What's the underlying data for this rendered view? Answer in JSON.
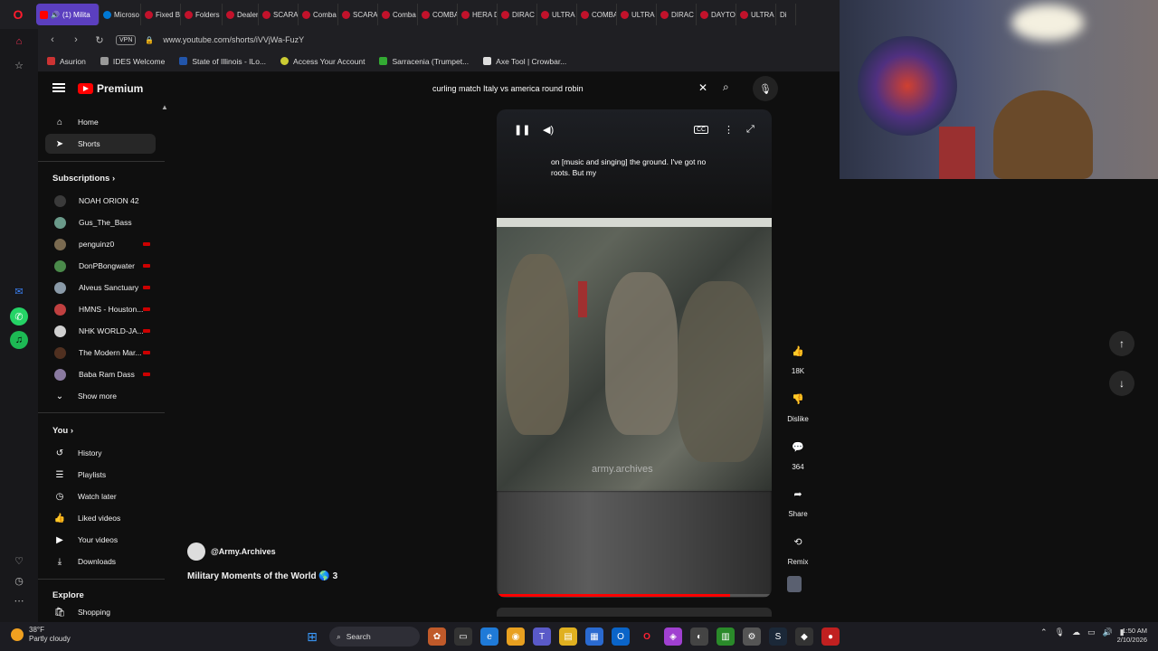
{
  "browser": {
    "tabs": [
      "(1) Milita",
      "Microso",
      "Fixed B",
      "Folders",
      "Dealer",
      "SCARA",
      "Comba",
      "SCARA",
      "Comba",
      "COMBA",
      "HERA D",
      "DIRAC",
      "ULTRA",
      "COMBA",
      "ULTRA",
      "DIRAC",
      "DAYTO",
      "ULTRA",
      "Di"
    ],
    "vpn_label": "VPN",
    "url": "www.youtube.com/shorts/iVVjWa-FuzY",
    "bookmarks": [
      "Asurion",
      "IDES Welcome",
      "State of Illinois - ILo...",
      "Access Your Account",
      "Sarracenia (Trumpet...",
      "Axe Tool | Crowbar..."
    ]
  },
  "youtube": {
    "logo": "Premium",
    "search_value": "curling match Italy vs america round robin",
    "nav": {
      "home": "Home",
      "shorts": "Shorts"
    },
    "subscriptions_title": "Subscriptions",
    "subscriptions": [
      {
        "name": "NOAH ORION 42",
        "color": "#3a3a3a",
        "live": false
      },
      {
        "name": "Gus_The_Bass",
        "color": "#6a9a8a",
        "live": false
      },
      {
        "name": "penguinz0",
        "color": "#7a6a50",
        "live": true
      },
      {
        "name": "DonPBongwater",
        "color": "#4a8a4a",
        "live": true
      },
      {
        "name": "Alveus Sanctuary",
        "color": "#8a9aa8",
        "live": true
      },
      {
        "name": "HMNS - Houston...",
        "color": "#c04040",
        "live": true
      },
      {
        "name": "NHK WORLD-JA...",
        "color": "#d0d0d0",
        "live": true
      },
      {
        "name": "The Modern Mar...",
        "color": "#503020",
        "live": true
      },
      {
        "name": "Baba Ram Dass",
        "color": "#8a7aa0",
        "live": true
      }
    ],
    "show_more": "Show more",
    "you_title": "You",
    "you_items": [
      "History",
      "Playlists",
      "Watch later",
      "Liked videos",
      "Your videos",
      "Downloads"
    ],
    "explore_title": "Explore",
    "explore_first": "Shopping"
  },
  "short": {
    "caption": "on [music and singing] the ground. I've got no roots. But my",
    "watermark": "army.archives",
    "progress": 0.85,
    "channel": "@Army.Archives",
    "title": "Military Moments of the World 🌎 3",
    "likes": "18K",
    "dislike": "Dislike",
    "comments": "364",
    "share": "Share",
    "remix": "Remix"
  },
  "taskbar": {
    "temp": "38°F",
    "weather": "Partly cloudy",
    "search": "Search",
    "time": "1:50 AM",
    "date": "2/10/2026"
  },
  "colors": {
    "accent": "#ff0000",
    "active_tab": "#5b3fbf"
  }
}
